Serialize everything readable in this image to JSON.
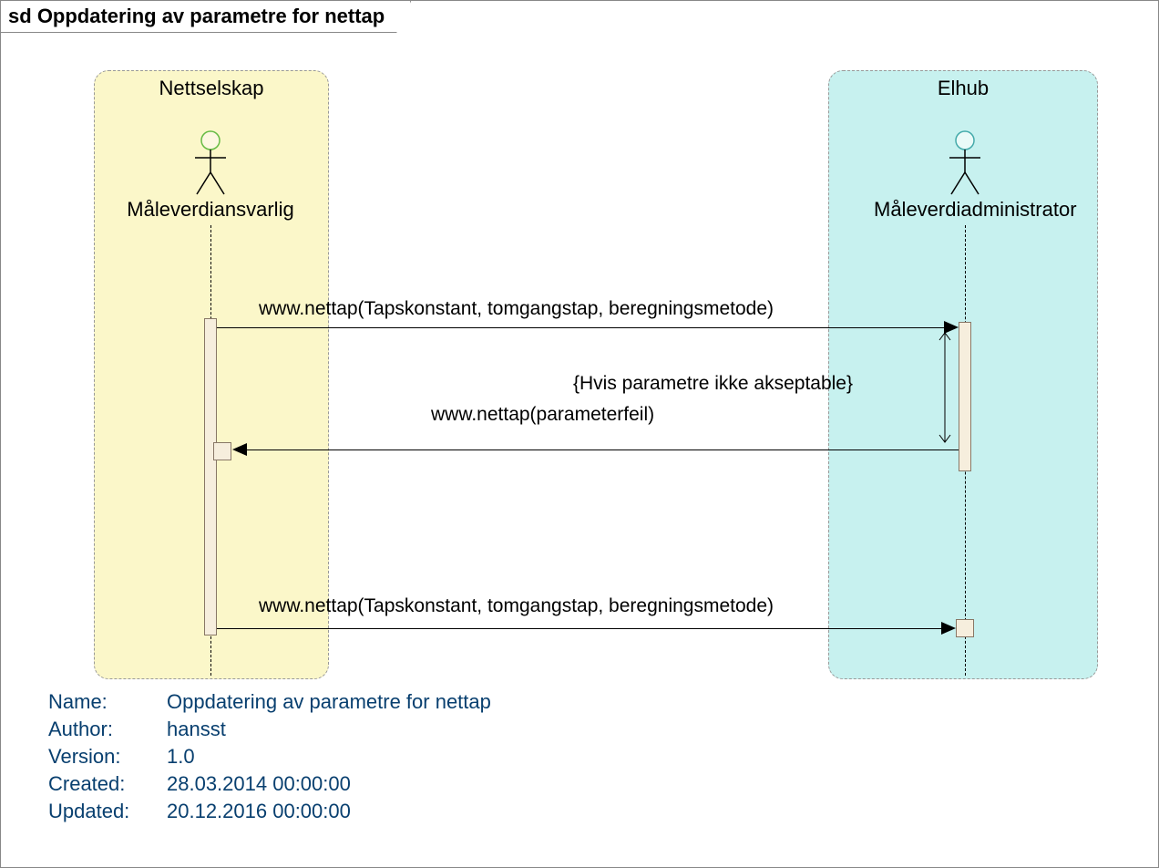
{
  "frame": {
    "prefix": "sd",
    "title": "Oppdatering av parametre for nettap"
  },
  "lanes": {
    "left": {
      "title": "Nettselskap"
    },
    "right": {
      "title": "Elhub"
    }
  },
  "actors": {
    "left": "Måleverdiansvarlig",
    "right": "Måleverdiadministrator"
  },
  "messages": {
    "m1": "www.nettap(Tapskonstant, tomgangstap, beregningsmetode)",
    "constraint": "{Hvis parametre ikke akseptable}",
    "m2": "www.nettap(parameterfeil)",
    "m3": "www.nettap(Tapskonstant, tomgangstap, beregningsmetode)"
  },
  "meta": {
    "name_label": "Name:",
    "name_value": "Oppdatering av parametre for nettap",
    "author_label": "Author:",
    "author_value": "hansst",
    "version_label": "Version:",
    "version_value": "1.0",
    "created_label": "Created:",
    "created_value": "28.03.2014 00:00:00",
    "updated_label": "Updated:",
    "updated_value": "20.12.2016 00:00:00"
  }
}
